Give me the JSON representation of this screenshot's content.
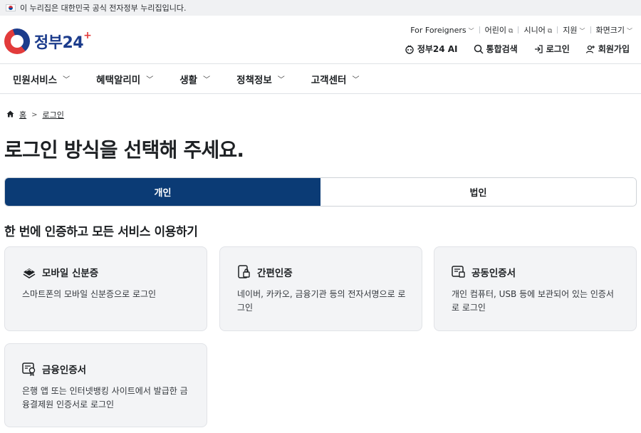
{
  "banner": {
    "text": "이 누리집은 대한민국 공식 전자정부 누리집입니다."
  },
  "logo": {
    "text_kr": "정부",
    "text_num": "24"
  },
  "util_links": [
    {
      "label": "For Foreigners",
      "icon": "chevron-down-icon"
    },
    {
      "label": "어린이",
      "icon": "external-link-icon"
    },
    {
      "label": "시니어",
      "icon": "external-link-icon"
    },
    {
      "label": "지원",
      "icon": "chevron-down-icon"
    },
    {
      "label": "화면크기",
      "icon": "chevron-down-icon"
    }
  ],
  "actions": [
    {
      "label": "정부24 AI",
      "icon": "ai-icon"
    },
    {
      "label": "통합검색",
      "icon": "search-icon"
    },
    {
      "label": "로그인",
      "icon": "login-icon"
    },
    {
      "label": "회원가입",
      "icon": "person-add-icon"
    }
  ],
  "nav": [
    {
      "label": "민원서비스"
    },
    {
      "label": "혜택알리미"
    },
    {
      "label": "생활"
    },
    {
      "label": "정책정보"
    },
    {
      "label": "고객센터"
    }
  ],
  "breadcrumb": {
    "home": "홈",
    "current": "로그인"
  },
  "page_title": "로그인 방식을 선택해 주세요.",
  "tabs": [
    {
      "label": "개인",
      "active": true
    },
    {
      "label": "법인",
      "active": false
    }
  ],
  "section_title": "한 번에 인증하고 모든 서비스 이용하기",
  "cards": [
    {
      "title": "모바일 신분증",
      "desc": "스마트폰의 모바일 신분증으로 로그인",
      "icon": "mobile-id-icon"
    },
    {
      "title": "간편인증",
      "desc": "네이버, 카카오, 금융기관 등의 전자서명으로 로그인",
      "icon": "simple-auth-icon"
    },
    {
      "title": "공동인증서",
      "desc": "개인 컴퓨터, USB 등에 보관되어 있는 인증서로 로그인",
      "icon": "joint-certificate-icon"
    },
    {
      "title": "금융인증서",
      "desc": "은행 앱 또는 인터넷뱅킹 사이트에서 발급한 금융결제원 인증서로 로그인",
      "icon": "financial-certificate-icon"
    }
  ],
  "colors": {
    "primary": "#0b3b75",
    "card_bg": "#f3f4f6",
    "logo_blue": "#1c3c8c",
    "logo_red": "#e23b3b"
  }
}
